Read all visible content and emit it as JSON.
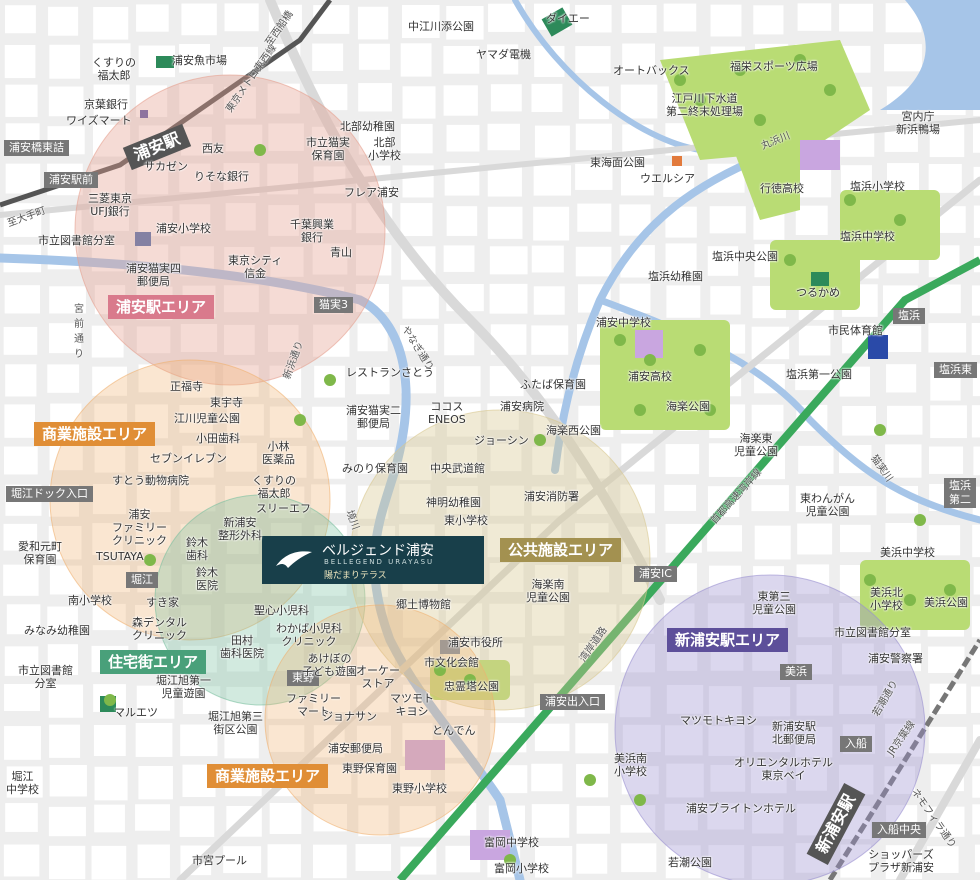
{
  "colors": {
    "background": "#eeeeee",
    "block": "#ffffff",
    "park": "#b9dc74",
    "river": "#a6c5e8",
    "school": "#c9a6e0",
    "jr_line": "#3aa95c",
    "area_urayasu": "#d97a8c",
    "area_commercial": "#e08e36",
    "area_residential": "#49a07a",
    "area_public": "#a39150",
    "area_shinurayasu": "#5d4f9a",
    "brand": "#183f4a"
  },
  "map_icons": [
    "tree-icon",
    "logo-leaf-icon",
    "railway-line-icon"
  ],
  "brand": {
    "name": "ベルジェンド浦安",
    "roman": "BELLEGEND URAYASU",
    "sub": "陽だまりテラス"
  },
  "areas": {
    "urayasu": "浦安駅エリア",
    "commercial_1": "商業施設エリア",
    "commercial_2": "商業施設エリア",
    "residential": "住宅街エリア",
    "public": "公共施設エリア",
    "shinurayasu": "新浦安駅エリア"
  },
  "stations": {
    "urayasu": "浦安駅",
    "shinurayasu": "新浦安駅"
  },
  "intersections": {
    "urayasu_hashizume": "浦安橋東詰",
    "urayasu_ekimae": "浦安駅前",
    "nekozane3": "猫実3",
    "horie_dock": "堀江ドック入口",
    "horie": "堀江",
    "higashino": "東野",
    "urayasu_ic": "浦安IC",
    "urayasu_exit": "浦安出入口",
    "mihama": "美浜",
    "irifune": "入船",
    "irifune_chuo": "入船中央",
    "shiohama": "塩浜",
    "shiohama_higashi": "塩浜東",
    "shiohama2": "塩浜\n第二"
  },
  "roads": {
    "tozai": "東京メトロ東西線",
    "shinnishibashi": "至西船橋",
    "otemachi": "至大手町",
    "miyamae": "宮\n前\n通\nり",
    "yanagi": "やなぎ通り",
    "shiohama_dori": "若潮通り",
    "bay_road": "湾岸道路",
    "shuto": "首都高速湾岸線",
    "marubama": "丸浜川",
    "nekozane": "猫実川",
    "jr_keiyo": "JR京葉線",
    "sakaigawa": "境川",
    "shinhama_dori": "新浜通り",
    "shiohama_kan": "ネモフィラ通り"
  },
  "labels": {
    "nakaedo_school": "中江川添公園",
    "daiei": "ダイエー",
    "yamada": "ヤマダ電機",
    "autobacs": "オートバックス",
    "fukuei_sports": "福栄スポーツ広場",
    "sewage": "江戸川下水道\n第二終末処理場",
    "kunaicho": "宮内庁\n新浜鴨場",
    "kusuri_fukutaro": "くすりの\n福太郎",
    "uoichiba": "浦安魚市場",
    "keiyo_bank": "京葉銀行",
    "wizmart": "ワイズマート",
    "sazen": "サカゼン",
    "seiyu": "西友",
    "risona": "りそな銀行",
    "mufg": "三菱東京\nUFJ銀行",
    "urayasu_elem": "浦安小学校",
    "library_bunshitsu": "市立図書館分室",
    "nekozane4_post": "浦安猫実四\n郵便局",
    "tokyo_city": "東京シティ\n信金",
    "chiba_kogyo": "千葉興業\n銀行",
    "aoyama": "青山",
    "flea": "フレア浦安",
    "hokubu_kinder": "北部幼稚園",
    "nekozane_nursery": "市立猫実\n保育園",
    "hokubu_elem": "北部\n小学校",
    "restaurant": "レストランさとう",
    "nekozane2_post": "浦安猫実二\n郵便局",
    "cocos": "ココス\nENEOS",
    "urayasu_hospital": "浦安病院",
    "futaba": "ふたば保育園",
    "josin": "ジョーシン",
    "kairaku_nishi": "海楽西公園",
    "minori": "みのり保育園",
    "chuo_road": "中央武道館",
    "kamiake": "神明幼稚園",
    "higashi_elem": "東小学校",
    "fire": "浦安消防署",
    "kyodo": "郷土博物館",
    "kairaku_minami": "海楽南\n児童公園",
    "city_hall": "浦安市役所",
    "culture": "市文化会館",
    "chureito": "忠霊塔公園",
    "shoganji": "正福寺",
    "tohoji": "東宇寺",
    "egawa_park": "江川児童公園",
    "oda_dental": "小田歯科",
    "seven": "セブンイレブン",
    "suto": "すとう動物病院",
    "kobayashi": "小林\n医薬品",
    "kusuri2": "くすりの\n福太郎",
    "three_f": "スリーエフ",
    "shinurayasu_surgery": "新浦安\n整形外科",
    "family_clinic": "浦安\nファミリー\nクリニック",
    "suzuki_dental": "鈴木\n歯科",
    "suzuki_clinic": "鈴木\n医院",
    "tsutaya": "TSUTAYA",
    "aiwa": "愛和元町\n保育園",
    "minami_elem": "南小学校",
    "minami_kinder": "みなみ幼稚園",
    "sukiya": "すき家",
    "mori_dental": "森デンタル\nクリニック",
    "seishin": "聖心小児科",
    "wakaba": "わかば小児科\nクリニック",
    "akebono": "あけぼの\n子ども遊園",
    "tada_dental": "田村\n歯科医院",
    "horie_asahi1": "堀江旭第一\n児童遊園",
    "maruetsu": "マルエツ",
    "library_horie": "市立図書館\n分室",
    "family_mart": "ファミリー\nマート",
    "jonasan": "ジョナサン",
    "okay": "オーケー\nストア",
    "matsumoto1": "マツモト\nキヨシ",
    "tonden": "とんでん",
    "horie_asahi3": "堀江旭第三\n街区公園",
    "urayasu_post": "浦安郵便局",
    "higashino_nursery": "東野保育園",
    "higashino_elem": "東野小学校",
    "horie_jr": "堀江\n中学校",
    "tomioka_jr": "富岡中学校",
    "tomioka_elem": "富岡小学校",
    "shimiya_pool": "市宮プール",
    "wakashio": "若潮公園",
    "tokai_park": "東海面公園",
    "welcia": "ウエルシア",
    "gyotoku_high": "行徳高校",
    "shiohama_elem": "塩浜小学校",
    "shiohama_jr": "塩浜中学校",
    "shiohama_chuo": "塩浜中央公園",
    "shiohama_kinder": "塩浜幼稚園",
    "tsurukame": "つるかめ",
    "gym": "市民体育館",
    "urayasu_jr": "浦安中学校",
    "urayasu_high": "浦安高校",
    "kairaku_park": "海楽公園",
    "shiohama1_park": "塩浜第一公園",
    "kairaku_higashi": "海楽東\n児童公園",
    "higashi_wangan": "東わんがん\n児童公園",
    "mihama_jr": "美浜中学校",
    "mihama_kita": "美浜北\n小学校",
    "mihama_park": "美浜公園",
    "higashi3": "東第三\n児童公園",
    "library_shin": "市立図書館分室",
    "police": "浦安警察署",
    "matsumoto2": "マツモトキヨシ",
    "shinurayasu_post": "新浦安駅\n北郵便局",
    "oriental": "オリエンタルホテル\n東京ベイ",
    "mihama_minami": "美浜南\n小学校",
    "brighton": "浦安ブライトンホテル",
    "shoppers": "ショッパーズ\nプラザ新浦安"
  }
}
